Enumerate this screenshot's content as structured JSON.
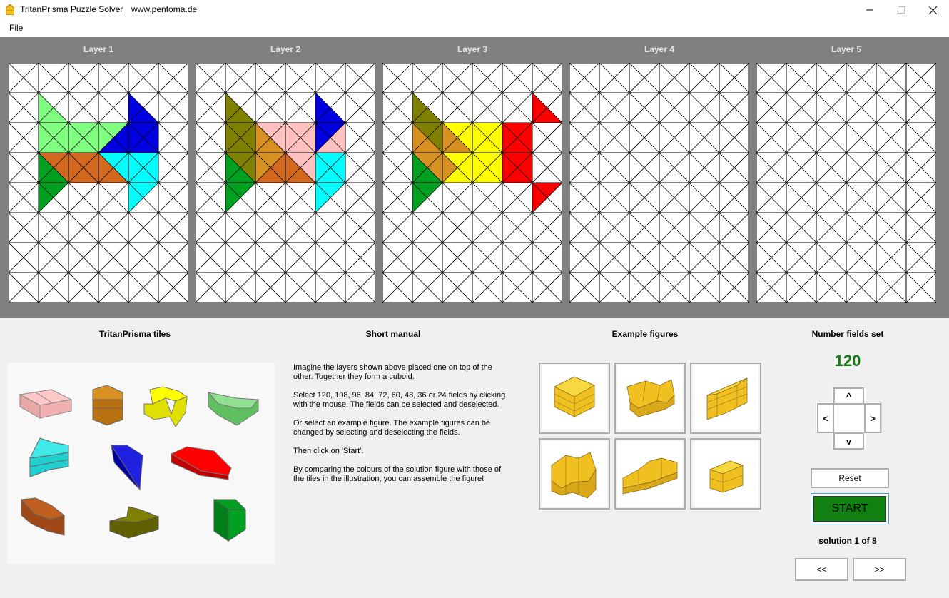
{
  "window": {
    "title": "TritanPrisma Puzzle Solver",
    "url": "www.pentoma.de",
    "minimize_icon": "minimize-icon",
    "maximize_icon": "maximize-icon",
    "close_icon": "close-icon"
  },
  "menu": {
    "file": "File"
  },
  "layers": [
    {
      "title": "Layer 1"
    },
    {
      "title": "Layer 2"
    },
    {
      "title": "Layer 3"
    },
    {
      "title": "Layer 4"
    },
    {
      "title": "Layer 5"
    }
  ],
  "grid": {
    "cols": 6,
    "rows": 8
  },
  "colors": {
    "light_green": "#80ff80",
    "blue": "#0000e0",
    "orange_brown": "#d2691e",
    "cyan": "#00ffff",
    "green": "#00a020",
    "olive": "#808000",
    "pink": "#ffc0c0",
    "dark_orange": "#d89020",
    "yellow": "#ffff00",
    "red": "#ff0000",
    "figure_yellow": "#f0c020",
    "start_green": "#108010",
    "count_green": "#107c10"
  },
  "sections": {
    "tiles_title": "TritanPrisma tiles",
    "manual_title": "Short manual",
    "figures_title": "Example figures",
    "fields_title": "Number fields set"
  },
  "manual": {
    "p1": "Imagine the layers shown above placed one on top of the other. Together they form a cuboid.",
    "p2": "Select 120, 108, 96, 84, 72, 60, 48, 36 or 24 fields by clicking with the mouse. The fields can be selected and deselected.",
    "p3": "Or select an example figure. The example figures can be changed by selecting and deselecting the fields.",
    "p4": "Then click on 'Start'.",
    "p5": "By comparing the colours of the solution figure with those of the tiles in the illustration, you can assemble the figure!"
  },
  "controls": {
    "fields_count": "120",
    "up": "^",
    "left": "<",
    "right": ">",
    "down": "v",
    "reset": "Reset",
    "start": "START",
    "solution_label": "solution",
    "solution_current": "1",
    "solution_of": "of",
    "solution_total": "8",
    "prev": "<<",
    "next": ">>"
  }
}
